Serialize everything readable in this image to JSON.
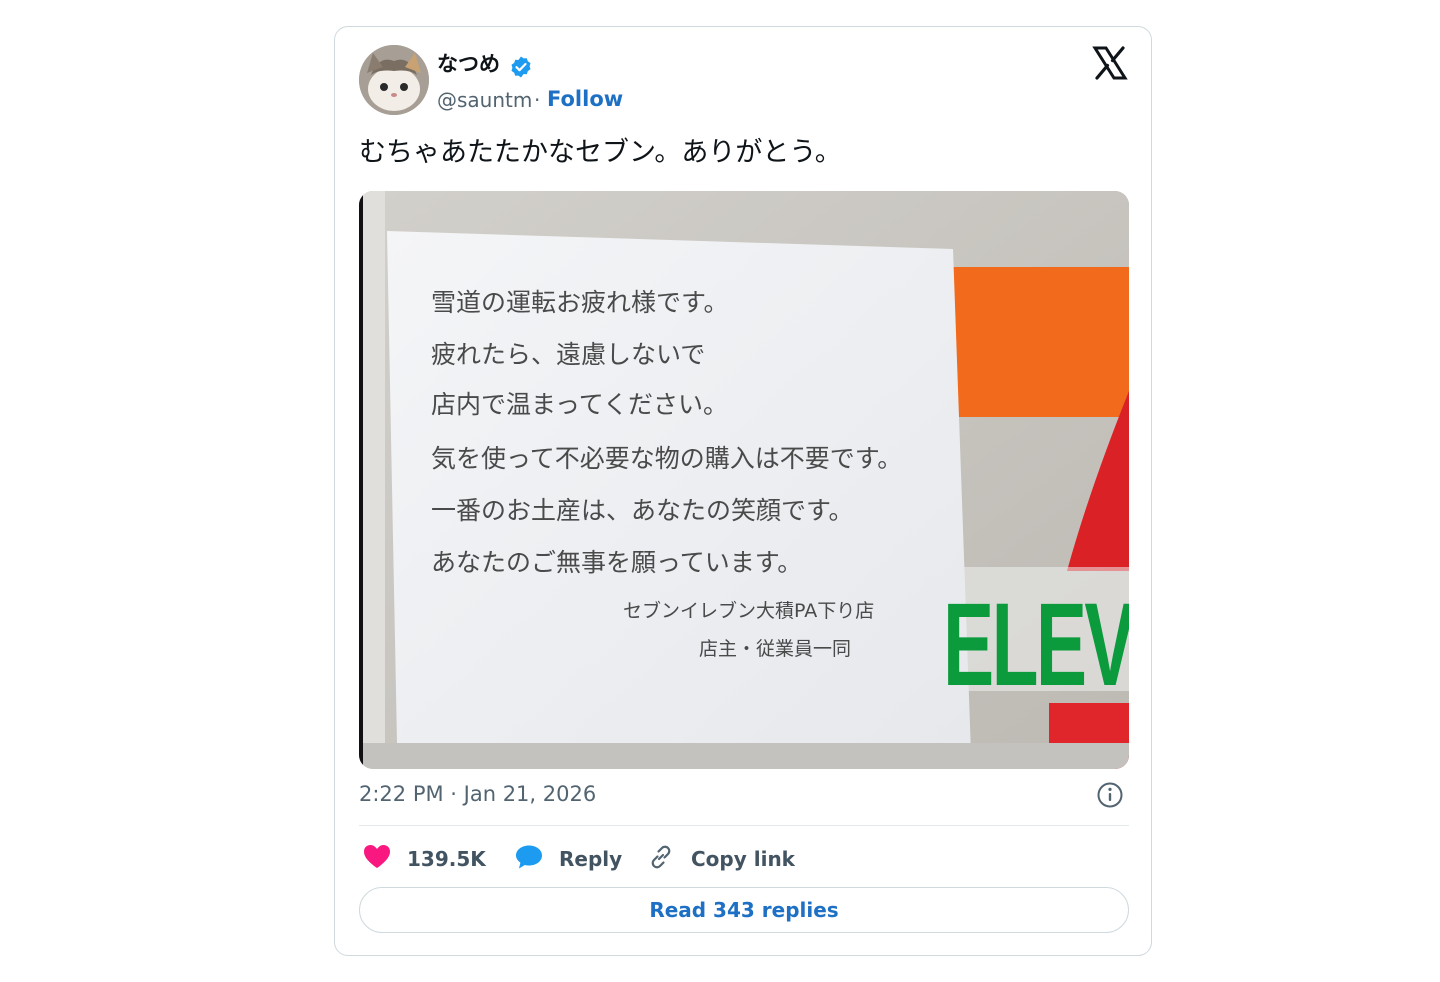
{
  "user": {
    "display_name": "なつめ",
    "handle": "@sauntm",
    "separator": "·",
    "follow_label": "Follow"
  },
  "tweet": {
    "text": "むちゃあたたかなセブン。ありがとう。",
    "timestamp": "2:22 PM · Jan 21, 2026"
  },
  "photo": {
    "sign_lines": [
      "雪道の運転お疲れ様です。",
      "疲れたら、遠慮しないで",
      "店内で温まってください。",
      "気を使って不必要な物の購入は不要です。",
      "一番のお土産は、あなたの笑顔です。",
      "あなたのご無事を願っています。"
    ],
    "sign_store": "セブンイレブン大積PA下り店",
    "sign_staff": "店主・従業員一同",
    "logo_text": "ELEV"
  },
  "actions": {
    "likes": "139.5K",
    "reply_label": "Reply",
    "copy_label": "Copy link",
    "read_replies_label": "Read 343 replies"
  },
  "icons": [
    "cat-avatar",
    "verified-badge-icon",
    "x-logo-icon",
    "info-icon",
    "heart-icon",
    "reply-bubble-icon",
    "link-icon"
  ],
  "colors": {
    "accent": "#1d9bf0",
    "link": "#1d70c4",
    "heart": "#f91880",
    "seven_orange": "#f26a1b",
    "seven_green": "#0b9a3c",
    "seven_red": "#e0262b"
  }
}
